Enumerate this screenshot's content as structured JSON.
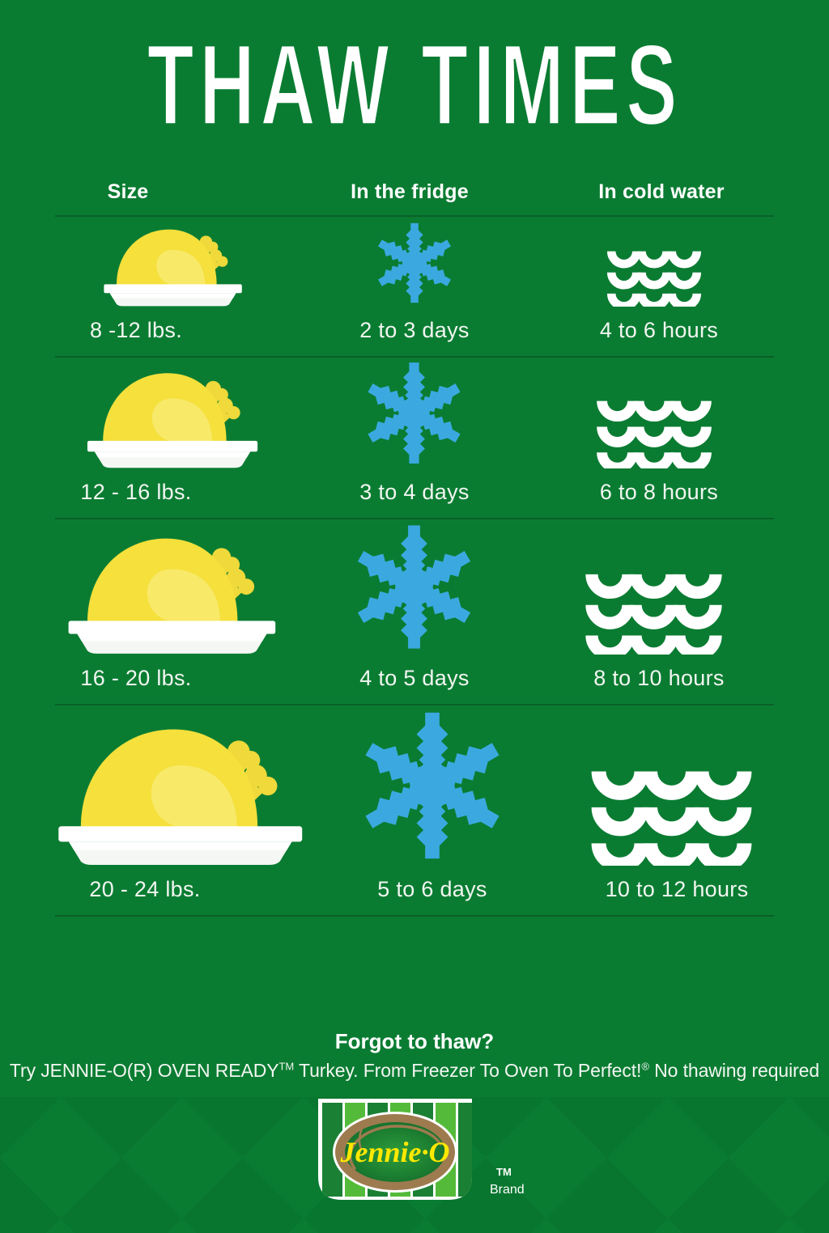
{
  "page": {
    "title": "THAW TIMES",
    "background_color": "#0a7c32",
    "accent_colors": {
      "green": "#0a7c32",
      "snow_blue": "#3ba9e0",
      "turkey_yellow": "#f5e03c",
      "turkey_highlight": "#f2e98a",
      "platter_white": "#ffffff",
      "divider": "#0a5f27",
      "logo_yellow": "#ffe800",
      "logo_brown": "#9d7b4f",
      "logo_green_dark": "#1a7a32",
      "logo_green_light": "#54bb3a"
    }
  },
  "table": {
    "headers": {
      "size": "Size",
      "fridge": "In the fridge",
      "water": "In cold water"
    },
    "rows": [
      {
        "size": "8 -12 lbs.",
        "fridge": "2 to 3 days",
        "water": "4 to 6 hours",
        "turkey_scale": 0.6,
        "snowflake_scale": 0.6,
        "waves_scale": 0.62
      },
      {
        "size": "12 - 16 lbs.",
        "fridge": "3 to 4 days",
        "water": "6 to 8 hours",
        "turkey_scale": 0.74,
        "snowflake_scale": 0.76,
        "waves_scale": 0.76
      },
      {
        "size": "16 - 20 lbs.",
        "fridge": "4 to 5 days",
        "water": "8 to 10 hours",
        "turkey_scale": 0.9,
        "snowflake_scale": 0.93,
        "waves_scale": 0.9
      },
      {
        "size": "20 - 24 lbs.",
        "fridge": "5 to 6 days",
        "water": "10 to 12 hours",
        "turkey_scale": 1.06,
        "snowflake_scale": 1.1,
        "waves_scale": 1.06
      }
    ]
  },
  "footer": {
    "headline": "Forgot to thaw?",
    "tagline_part1": "Try JENNIE-O(R) OVEN READY",
    "tagline_tm": "TM",
    "tagline_part2": " Turkey. From Freezer To Oven To Perfect!",
    "tagline_reg": "®",
    "tagline_part3": " No thawing required"
  },
  "logo": {
    "wordmark": "Jennie·O",
    "tm": "TM",
    "brand": "Brand"
  }
}
